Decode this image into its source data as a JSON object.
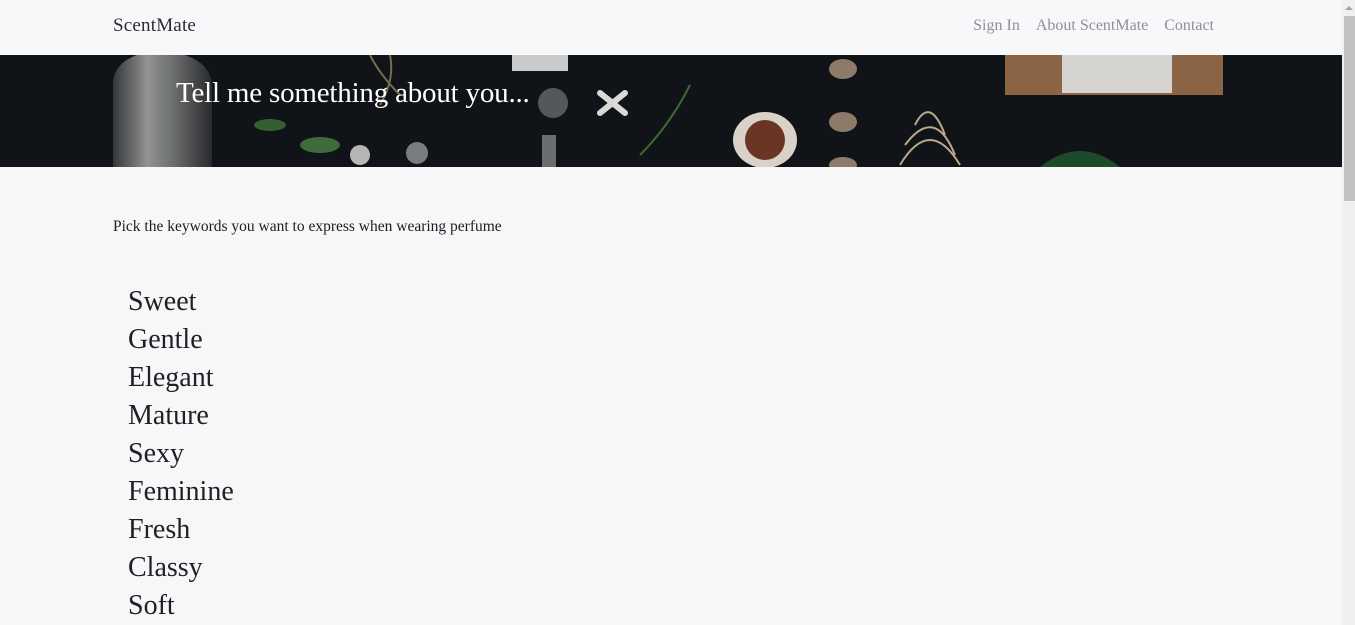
{
  "navbar": {
    "brand": "ScentMate",
    "links": [
      {
        "label": "Sign In"
      },
      {
        "label": "About ScentMate"
      },
      {
        "label": "Contact"
      }
    ]
  },
  "hero": {
    "title": "Tell me something about you..."
  },
  "main": {
    "prompt": "Pick the keywords you want to express when wearing perfume",
    "keywords": [
      "Sweet",
      "Gentle",
      "Elegant",
      "Mature",
      "Sexy",
      "Feminine",
      "Fresh",
      "Classy",
      "Soft"
    ]
  }
}
